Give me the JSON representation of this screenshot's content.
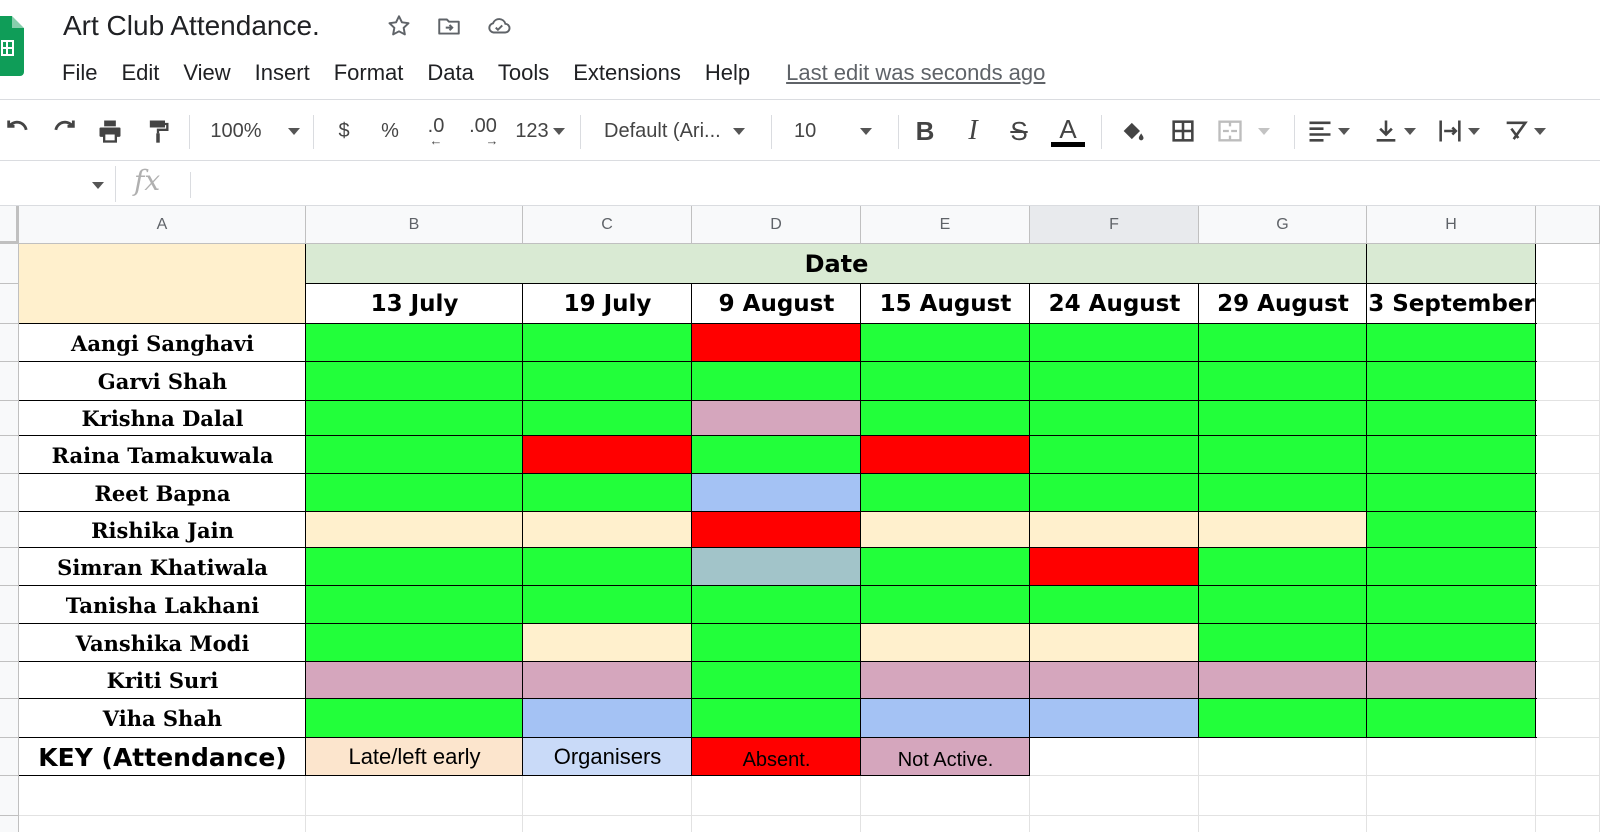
{
  "document": {
    "title": "Art Club Attendance.",
    "last_edit": "Last edit was seconds ago",
    "icons": [
      "star-icon",
      "move-to-folder-icon",
      "cloud-status-icon"
    ]
  },
  "menu": [
    "File",
    "Edit",
    "View",
    "Insert",
    "Format",
    "Data",
    "Tools",
    "Extensions",
    "Help"
  ],
  "toolbar": {
    "zoom": "100%",
    "currency": "$",
    "percent": "%",
    "decrease_decimal": ".0",
    "increase_decimal": ".00",
    "more_formats": "123",
    "font": "Default (Ari...",
    "font_size": "10",
    "bold": "B",
    "italic": "I",
    "strikethrough": "S",
    "text_color": "A"
  },
  "formula_bar": {
    "fx": "fx"
  },
  "columns": [
    "A",
    "B",
    "C",
    "D",
    "E",
    "F",
    "G",
    "H"
  ],
  "selected_column": "F",
  "colors": {
    "present": "#22ff3a",
    "absent": "#ff0000",
    "late": "#fff0cd",
    "organiser": "#a4c2f4",
    "not_active": "#d5a6bd",
    "grey": "#a2c4c9",
    "header": "#d9ead3",
    "empty": "#fff0cd"
  },
  "sheet": {
    "header_label": "Date",
    "dates": [
      "13 July",
      "19 July",
      "9 August",
      "15 August",
      "24 August",
      "29 August",
      "3 September"
    ],
    "rows": [
      {
        "name": "Aangi Sanghavi",
        "status": [
          "present",
          "present",
          "absent",
          "present",
          "present",
          "present",
          "present"
        ]
      },
      {
        "name": "Garvi Shah",
        "status": [
          "present",
          "present",
          "present",
          "present",
          "present",
          "present",
          "present"
        ]
      },
      {
        "name": "Krishna Dalal",
        "status": [
          "present",
          "present",
          "not_active",
          "present",
          "present",
          "present",
          "present"
        ]
      },
      {
        "name": "Raina Tamakuwala",
        "status": [
          "present",
          "absent",
          "present",
          "absent",
          "present",
          "present",
          "present"
        ]
      },
      {
        "name": "Reet Bapna",
        "status": [
          "present",
          "present",
          "organiser",
          "present",
          "present",
          "present",
          "present"
        ]
      },
      {
        "name": "Rishika Jain",
        "status": [
          "late",
          "late",
          "absent",
          "late",
          "late",
          "late",
          "present"
        ]
      },
      {
        "name": "Simran Khatiwala",
        "status": [
          "present",
          "present",
          "grey",
          "present",
          "absent",
          "present",
          "present"
        ]
      },
      {
        "name": "Tanisha Lakhani",
        "status": [
          "present",
          "present",
          "present",
          "present",
          "present",
          "present",
          "present"
        ]
      },
      {
        "name": "Vanshika Modi",
        "status": [
          "present",
          "late",
          "present",
          "late",
          "late",
          "present",
          "present"
        ]
      },
      {
        "name": "Kriti Suri",
        "status": [
          "not_active",
          "not_active",
          "present",
          "not_active",
          "not_active",
          "not_active",
          "not_active"
        ]
      },
      {
        "name": "Viha Shah",
        "status": [
          "present",
          "organiser",
          "present",
          "organiser",
          "organiser",
          "present",
          "present"
        ]
      }
    ],
    "key": {
      "title": "KEY (Attendance)",
      "items": [
        {
          "label": "Late/left early",
          "color": "#fce5cd"
        },
        {
          "label": "Organisers",
          "color": "#c9daf8"
        },
        {
          "label": "Absent.",
          "color": "#ff0000"
        },
        {
          "label": "Not Active.",
          "color": "#d5a6bd"
        }
      ]
    }
  }
}
